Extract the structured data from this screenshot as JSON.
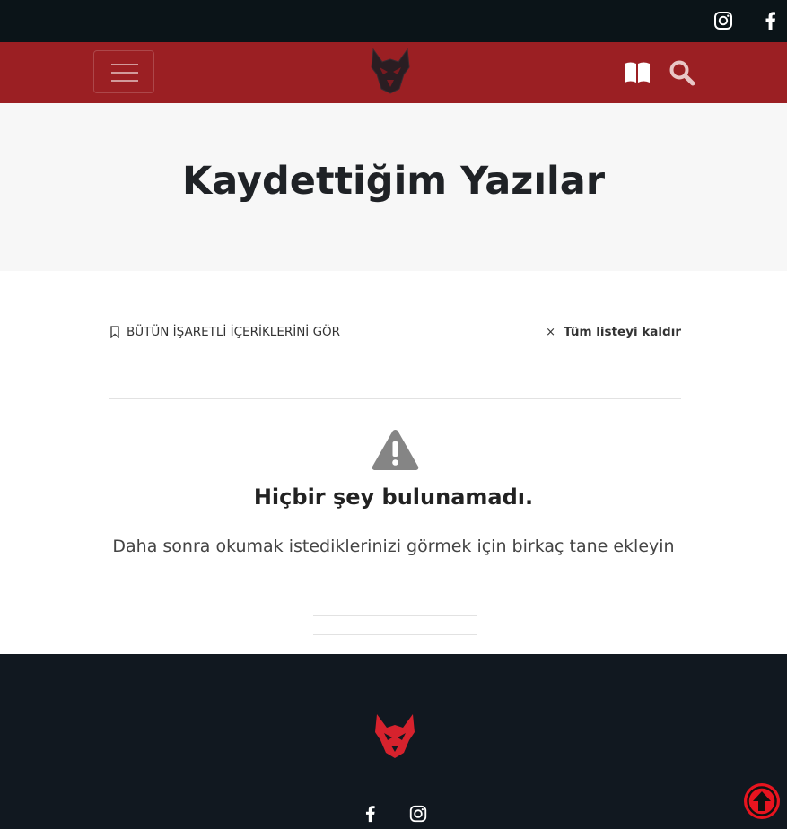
{
  "topbar": {
    "social": [
      {
        "icon": "instagram-icon"
      },
      {
        "icon": "facebook-icon"
      }
    ]
  },
  "header": {
    "menu_icon": "hamburger-menu-icon",
    "logo_icon": "wolf-logo-icon",
    "actions": [
      {
        "icon": "book-icon"
      },
      {
        "icon": "search-icon"
      }
    ]
  },
  "hero": {
    "title": "Kaydettiğim Yazılar"
  },
  "toolbar": {
    "view_all_label": "BÜTÜN İŞARETLİ İÇERİKLERİNİ GÖR",
    "remove_all_icon": "×",
    "remove_all_label": "Tüm listeyi kaldır"
  },
  "empty_state": {
    "icon": "warning-icon",
    "title": "Hiçbir şey bulunamadı.",
    "description": "Daha sonra okumak istediklerinizi görmek için birkaç tane ekleyin"
  },
  "footer": {
    "logo_icon": "wolf-logo-icon",
    "social": [
      {
        "icon": "facebook-icon"
      },
      {
        "icon": "instagram-icon"
      }
    ]
  },
  "scroll_top_icon": "arrow-up-icon",
  "colors": {
    "topbar_bg": "#0b1418",
    "header_bg": "#9b1f23",
    "hero_bg": "#f7f7f7",
    "footer_bg": "#111820",
    "accent_red": "#e8141f",
    "logo_footer_red": "#d6222d"
  }
}
